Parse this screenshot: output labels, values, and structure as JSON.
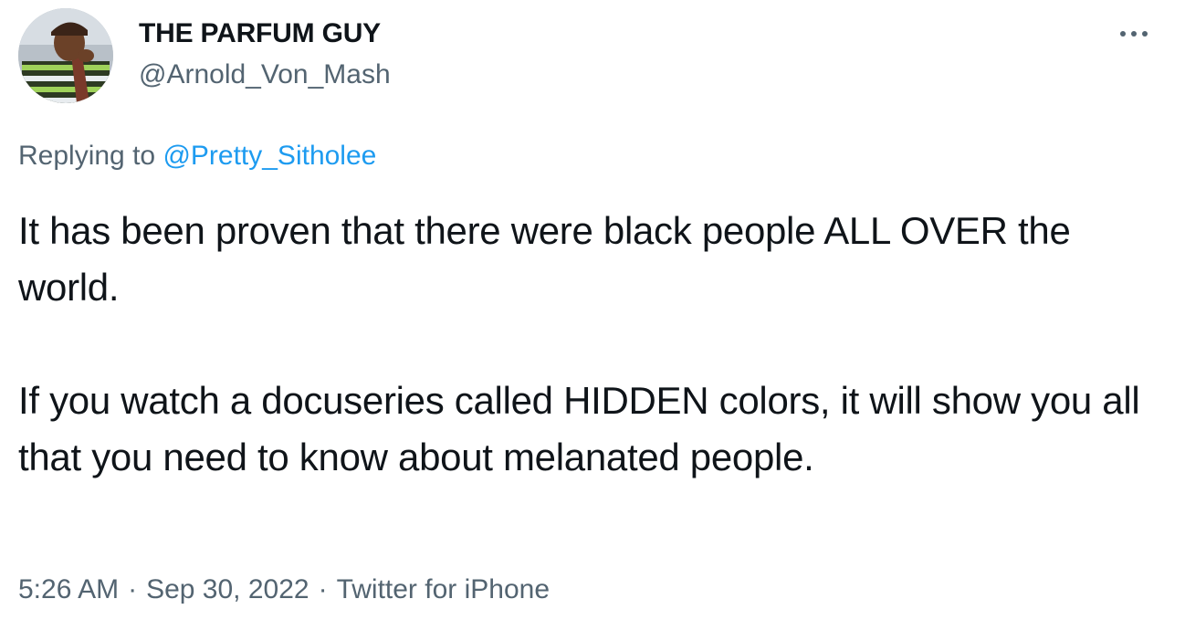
{
  "author": {
    "display_name": "THE PARFUM GUY",
    "handle": "@Arnold_Von_Mash"
  },
  "more_icon": "more-horizontal-icon",
  "reply": {
    "prefix": "Replying to",
    "mention": "@Pretty_Sitholee"
  },
  "tweet": {
    "paragraphs": [
      "It has been proven that there were black people ALL OVER the world.",
      "If you watch a docuseries called HIDDEN colors, it will show you all that you need to know about melanated people."
    ]
  },
  "meta": {
    "time": "5:26 AM",
    "separator": "·",
    "date": "Sep 30, 2022",
    "source": "Twitter for iPhone"
  },
  "colors": {
    "text": "#0f1419",
    "secondary": "#536471",
    "link": "#1d9bf0"
  }
}
